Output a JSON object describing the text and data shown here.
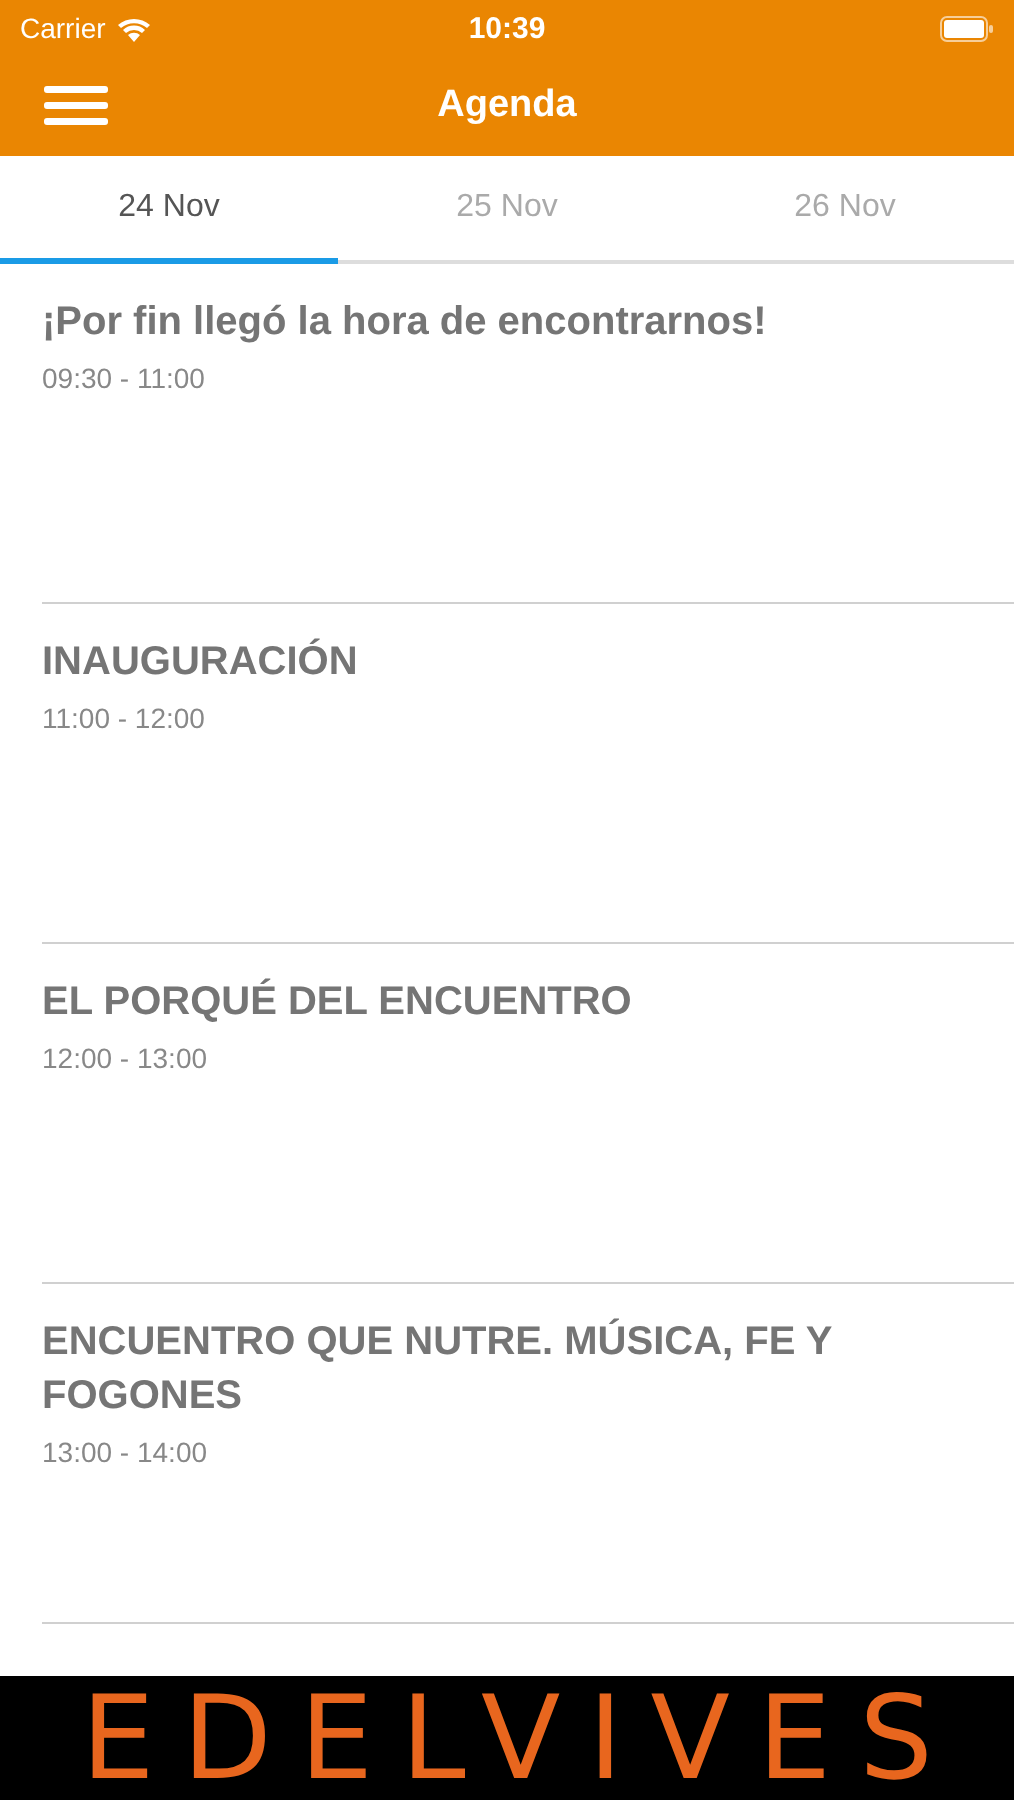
{
  "status_bar": {
    "carrier": "Carrier",
    "time": "10:39"
  },
  "nav_bar": {
    "title": "Agenda"
  },
  "tabs": [
    {
      "label": "24 Nov",
      "selected": true
    },
    {
      "label": "25 Nov",
      "selected": false
    },
    {
      "label": "26 Nov",
      "selected": false
    }
  ],
  "sessions": [
    {
      "title": "¡Por fin llegó la hora de encontrarnos!",
      "time": "09:30 - 11:00"
    },
    {
      "title": "INAUGURACIÓN",
      "time": "11:00 - 12:00"
    },
    {
      "title": "EL PORQUÉ DEL ENCUENTRO",
      "time": "12:00 - 13:00"
    },
    {
      "title": "ENCUENTRO QUE NUTRE. MÚSICA, FE Y FOGONES",
      "time": "13:00 - 14:00"
    }
  ],
  "banner": {
    "text": "EDELVIVES"
  }
}
